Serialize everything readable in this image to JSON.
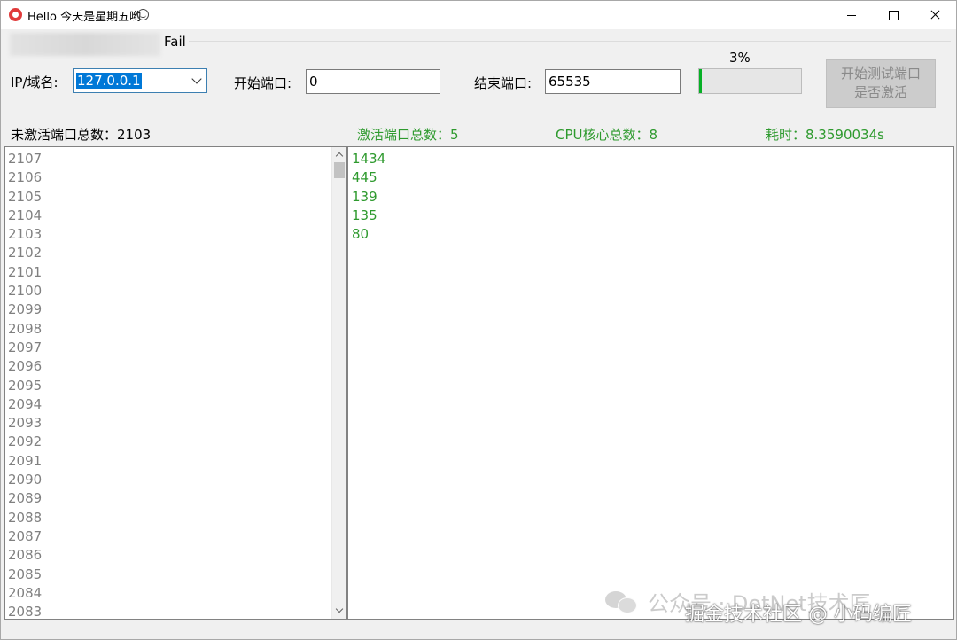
{
  "window": {
    "title": "Hello 今天是星期五哟",
    "title_emoji_icon": "smiley-face-icon",
    "app_icon": "app-logo-icon"
  },
  "status": {
    "fail_text": "Fail"
  },
  "form": {
    "ip_label": "IP/域名:",
    "ip_value": "127.0.0.1",
    "start_port_label": "开始端口:",
    "start_port_value": "0",
    "end_port_label": "结束端口:",
    "end_port_value": "65535",
    "progress_percent_text": "3%",
    "progress_value": 3,
    "start_button_line1": "开始测试端口",
    "start_button_line2": "是否激活"
  },
  "stats": {
    "inactive_total": "未激活端口总数：2103",
    "active_total": "激活端口总数：5",
    "cpu_cores": "CPU核心总数：8",
    "elapsed": "耗时：8.3590034s"
  },
  "inactive_ports": [
    "2107",
    "2106",
    "2105",
    "2104",
    "2103",
    "2102",
    "2101",
    "2100",
    "2099",
    "2098",
    "2097",
    "2096",
    "2095",
    "2094",
    "2093",
    "2092",
    "2091",
    "2090",
    "2089",
    "2088",
    "2087",
    "2086",
    "2085",
    "2084",
    "2083"
  ],
  "active_ports": [
    "1434",
    "445",
    "139",
    "135",
    "80"
  ],
  "watermark": {
    "line1": "公众号 · DotNet技术匠",
    "line2": "掘金技术社区 @ 小码编匠"
  },
  "colors": {
    "active_text": "#2e9a2e",
    "inactive_text": "#808080",
    "progress_fill": "#06b025",
    "selection": "#0078d7"
  }
}
